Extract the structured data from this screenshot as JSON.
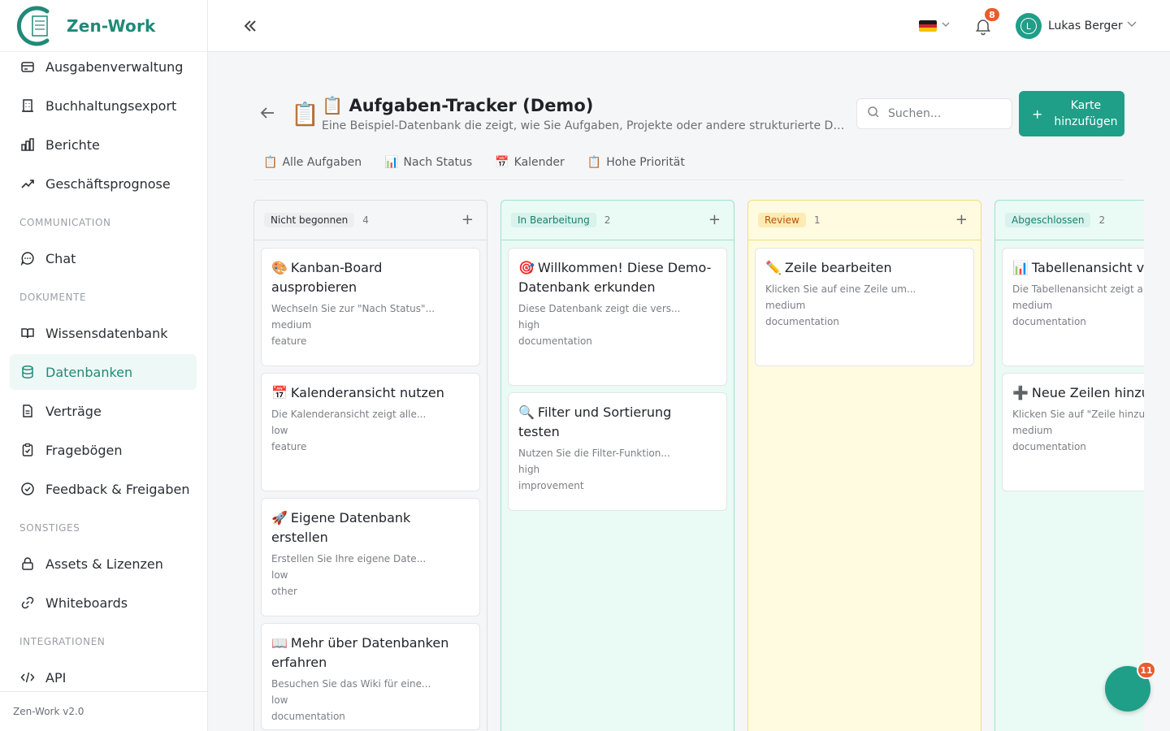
{
  "app": {
    "name": "Zen-Work",
    "version": "Zen-Work v2.0",
    "accent": "#1f9e88"
  },
  "sidebar": {
    "items_top": [
      {
        "label": "Ausgabenverwaltung",
        "icon": "wallet-icon"
      },
      {
        "label": "Buchhaltungsexport",
        "icon": "building-icon"
      },
      {
        "label": "Berichte",
        "icon": "bar-chart-icon"
      },
      {
        "label": "Geschäftsprognose",
        "icon": "trend-up-icon"
      }
    ],
    "sections": [
      {
        "label": "COMMUNICATION",
        "items": [
          {
            "label": "Chat",
            "icon": "chat-icon"
          }
        ]
      },
      {
        "label": "DOKUMENTE",
        "items": [
          {
            "label": "Wissensdatenbank",
            "icon": "book-icon"
          },
          {
            "label": "Datenbanken",
            "icon": "database-icon",
            "active": true
          },
          {
            "label": "Verträge",
            "icon": "document-icon"
          },
          {
            "label": "Fragebögen",
            "icon": "clipboard-check-icon"
          },
          {
            "label": "Feedback & Freigaben",
            "icon": "check-circle-icon"
          }
        ]
      },
      {
        "label": "SONSTIGES",
        "items": [
          {
            "label": "Assets & Lizenzen",
            "icon": "lock-icon"
          },
          {
            "label": "Whiteboards",
            "icon": "link-icon"
          }
        ]
      },
      {
        "label": "INTEGRATIONEN",
        "items": [
          {
            "label": "API",
            "icon": "code-icon"
          }
        ]
      }
    ]
  },
  "topbar": {
    "notifications_count": "8",
    "user_initial": "L",
    "user_name": "Lukas Berger",
    "language": "DE"
  },
  "page": {
    "icon": "📋",
    "title": "📋 Aufgaben-Tracker (Demo)",
    "description": "Eine Beispiel-Datenbank die zeigt, wie Sie Aufgaben, Projekte oder andere strukturierte Daten verwalten können.",
    "search_placeholder": "Suchen...",
    "add_card_label": "Karte hinzufügen",
    "views": [
      {
        "icon": "📋",
        "label": "Alle Aufgaben"
      },
      {
        "icon": "📊",
        "label": "Nach Status"
      },
      {
        "icon": "📅",
        "label": "Kalender"
      },
      {
        "icon": "📋",
        "label": "Hohe Priorität"
      }
    ]
  },
  "board": {
    "columns": [
      {
        "name": "Nicht begonnen",
        "count": "4",
        "badge_bg": "#eceef0",
        "badge_fg": "#2b2f33",
        "border": "#dcdfe2",
        "bg": "#f5f6f7",
        "cards": [
          {
            "emoji": "🎨",
            "title": "Kanban-Board ausprobieren",
            "desc": "Wechseln Sie zur \"Nach Status\"...",
            "priority": "medium",
            "type": "feature"
          },
          {
            "emoji": "📅",
            "title": "Kalenderansicht nutzen",
            "desc": "Die Kalenderansicht zeigt alle...",
            "priority": "low",
            "type": "feature"
          },
          {
            "emoji": "🚀",
            "title": "Eigene Datenbank erstellen",
            "desc": "Erstellen Sie Ihre eigene Date...",
            "priority": "low",
            "type": "other"
          },
          {
            "emoji": "📖",
            "title": "Mehr über Datenbanken erfahren",
            "desc": "Besuchen Sie das Wiki für eine...",
            "priority": "low",
            "type": "documentation"
          }
        ]
      },
      {
        "name": "In Bearbeitung",
        "count": "2",
        "badge_bg": "#d7f3ec",
        "badge_fg": "#1a7f6c",
        "border": "#9fe0cf",
        "bg": "#eafaf5",
        "cards": [
          {
            "emoji": "🎯",
            "title": "Willkommen! Diese Demo-Datenbank erkunden",
            "desc": "Diese Datenbank zeigt die vers...",
            "priority": "high",
            "type": "documentation"
          },
          {
            "emoji": "🔍",
            "title": "Filter und Sortierung testen",
            "desc": "Nutzen Sie die Filter-Funktion...",
            "priority": "high",
            "type": "improvement"
          }
        ]
      },
      {
        "name": "Review",
        "count": "1",
        "badge_bg": "#fdebb3",
        "badge_fg": "#b4540a",
        "border": "#f2dc86",
        "bg": "#fffbe0",
        "cards": [
          {
            "emoji": "✏️",
            "title": "Zeile bearbeiten",
            "desc": "Klicken Sie auf eine Zeile um...",
            "priority": "medium",
            "type": "documentation"
          }
        ]
      },
      {
        "name": "Abgeschlossen",
        "count": "2",
        "badge_bg": "#d7f3ec",
        "badge_fg": "#1a7f6c",
        "border": "#9fe0cf",
        "bg": "#eafaf5",
        "cards": [
          {
            "emoji": "📊",
            "title": "Tabellenansicht verwenden",
            "desc": "Die Tabellenansicht zeigt alle...",
            "priority": "medium",
            "type": "documentation"
          },
          {
            "emoji": "➕",
            "title": "Neue Zeilen hinzufügen",
            "desc": "Klicken Sie auf \"Zeile hinzufü...",
            "priority": "medium",
            "type": "documentation"
          }
        ]
      }
    ]
  },
  "chat_fab": {
    "badge": "11"
  }
}
